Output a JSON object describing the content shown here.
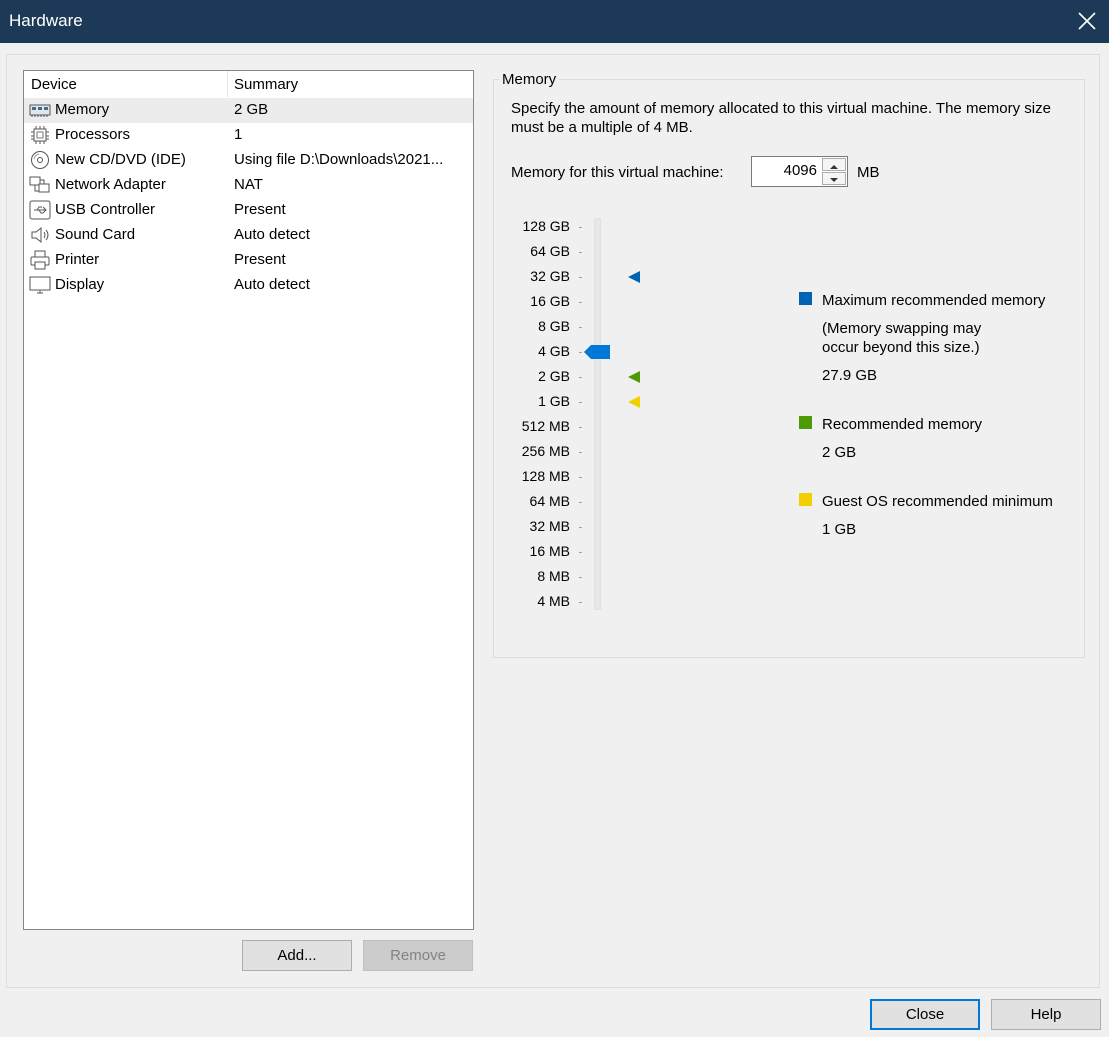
{
  "window": {
    "title": "Hardware"
  },
  "device_list": {
    "columns": {
      "device": "Device",
      "summary": "Summary"
    },
    "items": [
      {
        "name": "Memory",
        "summary": "2 GB",
        "icon": "memory-icon",
        "selected": true
      },
      {
        "name": "Processors",
        "summary": "1",
        "icon": "processor-icon"
      },
      {
        "name": "New CD/DVD (IDE)",
        "summary": "Using file D:\\Downloads\\2021...",
        "icon": "cd-dvd-icon"
      },
      {
        "name": "Network Adapter",
        "summary": "NAT",
        "icon": "network-adapter-icon"
      },
      {
        "name": "USB Controller",
        "summary": "Present",
        "icon": "usb-icon"
      },
      {
        "name": "Sound Card",
        "summary": "Auto detect",
        "icon": "speaker-icon"
      },
      {
        "name": "Printer",
        "summary": "Present",
        "icon": "printer-icon"
      },
      {
        "name": "Display",
        "summary": "Auto detect",
        "icon": "monitor-icon"
      }
    ],
    "add_label": "Add...",
    "remove_label": "Remove"
  },
  "memory": {
    "group_title": "Memory",
    "description": "Specify the amount of memory allocated to this virtual machine. The memory size must be a multiple of 4 MB.",
    "field_label": "Memory for this virtual machine:",
    "value": "4096",
    "unit": "MB",
    "scale": [
      "128 GB",
      "64 GB",
      "32 GB",
      "16 GB",
      "8 GB",
      "4 GB",
      "2 GB",
      "1 GB",
      "512 MB",
      "256 MB",
      "128 MB",
      "64 MB",
      "32 MB",
      "16 MB",
      "8 MB",
      "4 MB"
    ],
    "slider_level": "4 GB",
    "markers": {
      "max_recommended": "32 GB",
      "recommended": "2 GB",
      "guest_min": "1 GB"
    },
    "legend": {
      "max": {
        "label": "Maximum recommended memory",
        "note1": "(Memory swapping may",
        "note2": "occur beyond this size.)",
        "value": "27.9 GB",
        "color": "#0063b1"
      },
      "recommended": {
        "label": "Recommended memory",
        "value": "2 GB",
        "color": "#4e9a06"
      },
      "guest_min": {
        "label": "Guest OS recommended minimum",
        "value": "1 GB",
        "color": "#f2d000"
      }
    }
  },
  "footer": {
    "close_label": "Close",
    "help_label": "Help"
  },
  "colors": {
    "titlebar": "#1c3a57",
    "slider_thumb": "#0078d7",
    "accent": "#0078d7"
  }
}
